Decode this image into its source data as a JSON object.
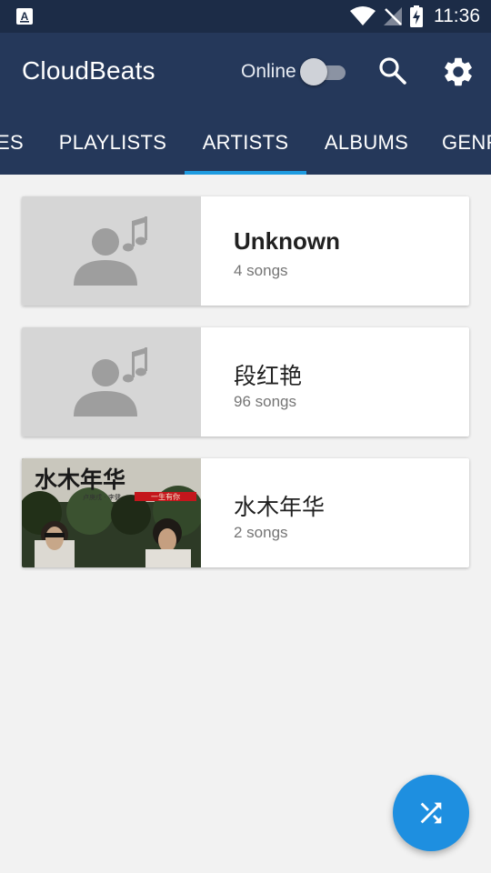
{
  "status_bar": {
    "time": "11:36"
  },
  "app_bar": {
    "title": "CloudBeats",
    "online_label": "Online",
    "online_enabled": false
  },
  "tabs": [
    {
      "label": "ES",
      "active": false
    },
    {
      "label": "PLAYLISTS",
      "active": false
    },
    {
      "label": "ARTISTS",
      "active": true
    },
    {
      "label": "ALBUMS",
      "active": false
    },
    {
      "label": "GENRES",
      "active": false
    }
  ],
  "artists": [
    {
      "name": "Unknown",
      "count": "4 songs",
      "thumbnail": "artist-placeholder-icon"
    },
    {
      "name": "段红艳",
      "count": "96 songs",
      "thumbnail": "artist-placeholder-icon"
    },
    {
      "name": "水木年华",
      "count": "2 songs",
      "thumbnail": "album-art"
    }
  ],
  "album_art": {
    "title_text": "水木年华",
    "subtitle_text": "一生有你",
    "credits_text": "卢庚戌 · 李健"
  },
  "colors": {
    "status_bar": "#1c2c47",
    "app_bar": "#25385a",
    "tab_indicator": "#1e9be0",
    "fab": "#1e8fe0",
    "background": "#f2f2f2"
  },
  "fab": {
    "icon": "shuffle-icon"
  }
}
